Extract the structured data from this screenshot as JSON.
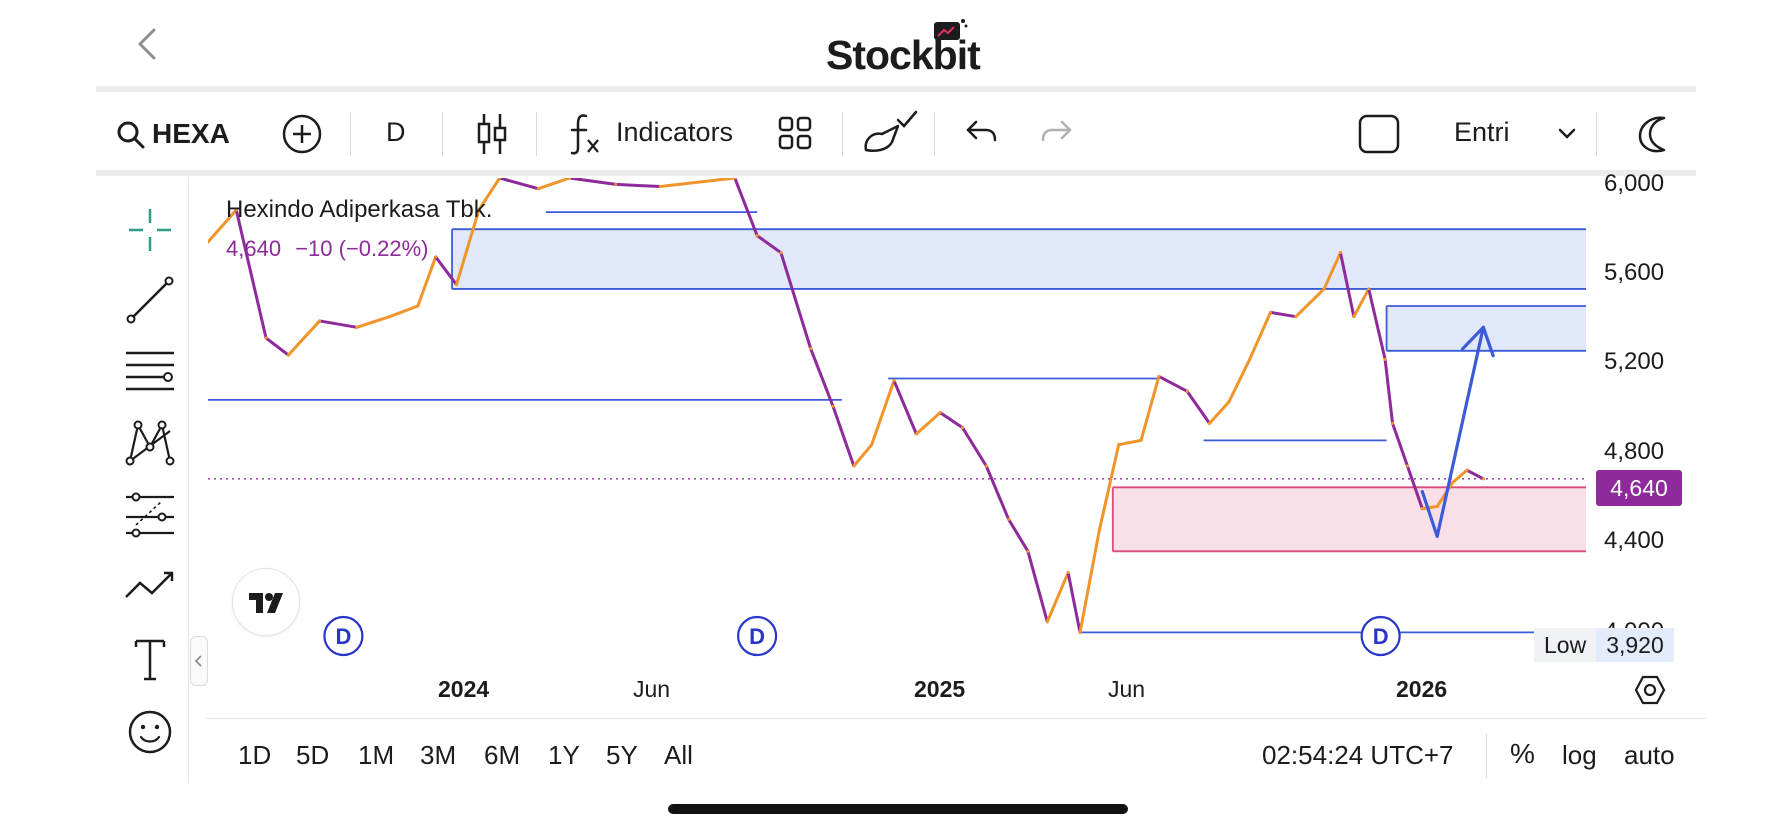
{
  "app": {
    "logo_text": "Stockbit"
  },
  "toolbar": {
    "symbol": "HEXA",
    "interval": "D",
    "indicators_label": "Indicators",
    "template_label": "Entri"
  },
  "legend": {
    "name": "Hexindo Adiperkasa Tbk.",
    "price": "4,640",
    "change": "−10 (−0.22%)"
  },
  "price_label": {
    "value": "4,640",
    "color": "#8e2a9c"
  },
  "low_label": {
    "label": "Low",
    "value": "3,920"
  },
  "colors": {
    "up": "#f0952a",
    "down": "#8e2a9c",
    "lines": "#3b5bd9",
    "zone_blue": "#dde6fa",
    "zone_pink": "#f7dce6",
    "pink_border": "#d9497a"
  },
  "range_buttons": [
    "1D",
    "5D",
    "1M",
    "3M",
    "6M",
    "1Y",
    "5Y",
    "All"
  ],
  "footer": {
    "time": "02:54:24 UTC+7",
    "percent": "%",
    "log": "log",
    "auto": "auto"
  },
  "chart_data": {
    "type": "line",
    "title": "Hexindo Adiperkasa Tbk.",
    "y_ticks": [
      "6,000",
      "5,600",
      "5,200",
      "4,800",
      "4,400",
      "4,000"
    ],
    "x_ticks": [
      {
        "label": "2024",
        "bold": true
      },
      {
        "label": "Jun",
        "bold": false
      },
      {
        "label": "2025",
        "bold": true
      },
      {
        "label": "Jun",
        "bold": false
      },
      {
        "label": "2026",
        "bold": true
      }
    ],
    "ylim": [
      3800,
      6050
    ],
    "xlim": [
      "2023-09-01",
      "2026-03-15"
    ],
    "series": [
      {
        "values": [
          [
            "2023-09-01",
            5750
          ],
          [
            "2023-09-20",
            5900
          ],
          [
            "2023-10-10",
            5300
          ],
          [
            "2023-10-25",
            5220
          ],
          [
            "2023-11-15",
            5380
          ],
          [
            "2023-12-10",
            5350
          ],
          [
            "2024-01-01",
            5400
          ],
          [
            "2024-01-20",
            5450
          ],
          [
            "2024-02-01",
            5680
          ],
          [
            "2024-02-15",
            5550
          ],
          [
            "2024-03-01",
            5900
          ],
          [
            "2024-03-15",
            6050
          ],
          [
            "2024-04-10",
            6000
          ],
          [
            "2024-05-01",
            6050
          ],
          [
            "2024-06-01",
            6020
          ],
          [
            "2024-07-01",
            6010
          ],
          [
            "2024-08-20",
            6050
          ],
          [
            "2024-09-04",
            5780
          ],
          [
            "2024-09-20",
            5700
          ],
          [
            "2024-10-10",
            5250
          ],
          [
            "2024-10-25",
            4980
          ],
          [
            "2024-11-08",
            4700
          ],
          [
            "2024-11-20",
            4800
          ],
          [
            "2024-12-05",
            5100
          ],
          [
            "2024-12-20",
            4850
          ],
          [
            "2025-01-05",
            4950
          ],
          [
            "2025-01-20",
            4880
          ],
          [
            "2025-02-05",
            4700
          ],
          [
            "2025-02-20",
            4450
          ],
          [
            "2025-03-05",
            4300
          ],
          [
            "2025-03-18",
            3970
          ],
          [
            "2025-04-01",
            4200
          ],
          [
            "2025-04-09",
            3920
          ],
          [
            "2025-04-22",
            4400
          ],
          [
            "2025-05-05",
            4800
          ],
          [
            "2025-05-20",
            4820
          ],
          [
            "2025-06-01",
            5120
          ],
          [
            "2025-06-20",
            5050
          ],
          [
            "2025-07-05",
            4900
          ],
          [
            "2025-07-18",
            5000
          ],
          [
            "2025-08-01",
            5200
          ],
          [
            "2025-08-15",
            5420
          ],
          [
            "2025-09-01",
            5400
          ],
          [
            "2025-09-20",
            5530
          ],
          [
            "2025-10-01",
            5700
          ],
          [
            "2025-10-10",
            5400
          ],
          [
            "2025-10-20",
            5530
          ],
          [
            "2025-10-31",
            5200
          ],
          [
            "2025-11-05",
            4900
          ],
          [
            "2025-11-15",
            4700
          ],
          [
            "2025-11-25",
            4500
          ],
          [
            "2025-12-05",
            4510
          ],
          [
            "2025-12-15",
            4620
          ],
          [
            "2025-12-25",
            4680
          ],
          [
            "2026-01-05",
            4640
          ]
        ]
      }
    ],
    "annotations": {
      "zones": [
        {
          "x0": "2024-02-12",
          "x1": "2026-03-15",
          "y0": 5530,
          "y1": 5810,
          "color": "blue"
        },
        {
          "x0": "2025-11-01",
          "x1": "2026-03-15",
          "y0": 5240,
          "y1": 5450,
          "color": "blue"
        },
        {
          "x0": "2025-05-01",
          "x1": "2026-03-15",
          "y0": 4300,
          "y1": 4600,
          "color": "pink"
        }
      ],
      "hlines": [
        {
          "x0": "2023-09-01",
          "x1": "2024-10-31",
          "y": 5010
        },
        {
          "x0": "2024-12-01",
          "x1": "2025-05-31",
          "y": 5110
        },
        {
          "x0": "2024-04-15",
          "x1": "2024-09-04",
          "y": 5890
        },
        {
          "x0": "2025-07-01",
          "x1": "2025-11-01",
          "y": 4820
        },
        {
          "x0": "2025-04-09",
          "x1": "2026-03-15",
          "y": 3920
        }
      ],
      "current_price_line": 4640,
      "dividend_markers": [
        "2023-12-01",
        "2024-09-04",
        "2025-10-28"
      ],
      "projection_arrow": [
        [
          "2025-11-25",
          4580
        ],
        [
          "2025-12-05",
          4370
        ],
        [
          "2026-01-05",
          5350
        ]
      ]
    }
  }
}
